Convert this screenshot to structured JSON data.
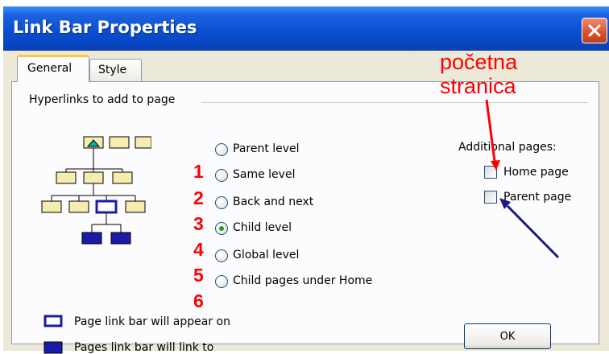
{
  "window": {
    "title": "Link Bar Properties",
    "close_icon": "close-icon"
  },
  "tabs": [
    {
      "label": "General",
      "selected": true
    },
    {
      "label": "Style",
      "selected": false
    }
  ],
  "group": {
    "label": "Hyperlinks to add to page"
  },
  "radio_options": [
    {
      "label": "Parent level",
      "selected": false
    },
    {
      "label": "Same level",
      "selected": false
    },
    {
      "label": "Back and next",
      "selected": false
    },
    {
      "label": "Child level",
      "selected": true
    },
    {
      "label": "Global level",
      "selected": false
    },
    {
      "label": "Child pages under Home",
      "selected": false
    }
  ],
  "annotation_numbers": [
    "1",
    "2",
    "3",
    "4",
    "5",
    "6"
  ],
  "additional_pages": {
    "label": "Additional pages:",
    "options": [
      {
        "label": "Home page",
        "checked": false
      },
      {
        "label": "Parent page",
        "checked": false
      }
    ]
  },
  "annotation": {
    "line1": "početna",
    "line2": "stranica",
    "color": "#ff0000"
  },
  "legend": {
    "item1": "Page link bar will appear on",
    "item2": "Pages link bar will link to"
  },
  "buttons": {
    "ok": "OK"
  },
  "colors": {
    "titlebar": "#0a4fd0",
    "dialog_bg": "#ece9d8",
    "panel_bg": "#fcfcfe",
    "tab_highlight": "#ffc83c",
    "annotation_red": "#ff0000",
    "arrow_navy": "#1a1a80",
    "page_box_fill": "#f5ecb0",
    "linked_page_fill": "#1b1baa"
  }
}
